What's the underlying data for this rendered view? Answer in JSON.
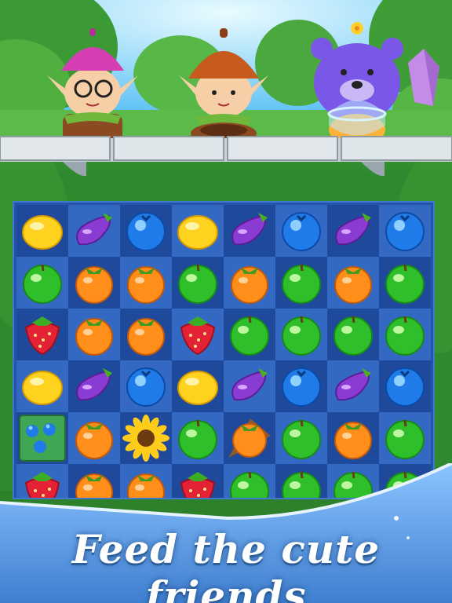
{
  "tagline": "Feed the cute friends",
  "characters": [
    {
      "name": "elf-girl-pink-hat",
      "hat_color": "#d63fb4",
      "bowl_color": "#8b4a22"
    },
    {
      "name": "elf-boy-acorn-hat",
      "hat_color": "#c75b1e",
      "bowl_color": "#8b4a22"
    },
    {
      "name": "purple-bear",
      "fur_color": "#7a57e6",
      "bowl_color": "#ffb23a"
    }
  ],
  "board": {
    "columns": 8,
    "rows": 6,
    "grid": [
      [
        "lemon",
        "eggplant",
        "blueberry",
        "lemon",
        "eggplant",
        "blueberry",
        "eggplant",
        "blueberry"
      ],
      [
        "apple",
        "persimmon",
        "persimmon",
        "apple",
        "persimmon",
        "apple",
        "persimmon",
        "apple"
      ],
      [
        "strawberry",
        "persimmon",
        "persimmon",
        "strawberry",
        "apple",
        "apple",
        "apple",
        "apple"
      ],
      [
        "lemon",
        "eggplant",
        "blueberry",
        "lemon",
        "eggplant",
        "blueberry",
        "eggplant",
        "blueberry"
      ],
      [
        "blueberry-box",
        "persimmon",
        "sunflower",
        "apple",
        "persimmon-leaf",
        "apple",
        "persimmon",
        "apple"
      ],
      [
        "strawberry",
        "persimmon",
        "persimmon",
        "strawberry",
        "apple",
        "apple",
        "apple",
        "apple"
      ]
    ]
  },
  "colors": {
    "board_bg": "#2453a8",
    "banner": "#4d8fd6",
    "tagline_text": "#ffffff"
  }
}
